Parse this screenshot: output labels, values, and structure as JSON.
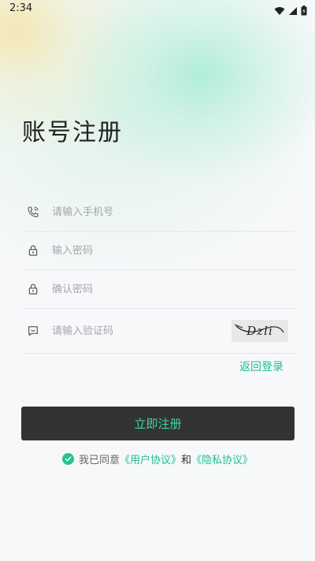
{
  "status_bar": {
    "time": "2:34"
  },
  "page": {
    "title": "账号注册"
  },
  "form": {
    "phone": {
      "placeholder": "请输入手机号",
      "value": ""
    },
    "password": {
      "placeholder": "输入密码",
      "value": ""
    },
    "confirm_password": {
      "placeholder": "确认密码",
      "value": ""
    },
    "captcha": {
      "placeholder": "请输入验证码",
      "value": "",
      "image_text": "Dzli"
    }
  },
  "back_login": "返回登录",
  "register_button": "立即注册",
  "agreement": {
    "prefix": "我已同意",
    "user_agreement": "《用户协议》",
    "and": "和",
    "privacy_agreement": "《隐私协议》"
  },
  "colors": {
    "accent": "#1fbf8f",
    "button_bg": "#333333",
    "button_text": "#3fd6a4",
    "check": "#25c48f"
  },
  "icons": {
    "phone": "phone-icon",
    "lock": "lock-icon",
    "captcha": "message-icon",
    "check": "check-circle-icon"
  }
}
